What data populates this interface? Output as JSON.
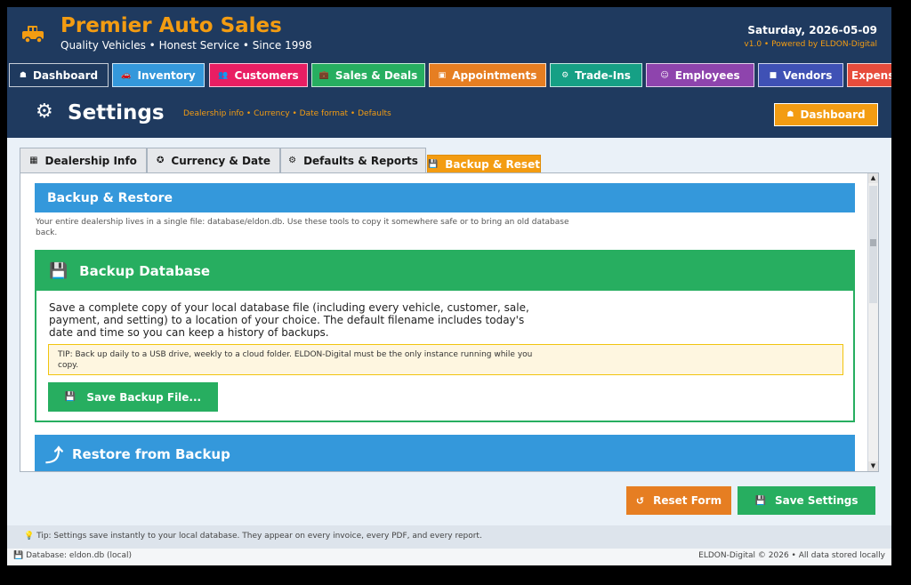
{
  "header": {
    "app_title": "Premier Auto Sales",
    "tagline": "Quality Vehicles  •  Honest Service  •  Since 1998",
    "date": "Saturday, 2026-05-09",
    "version": "v1.0  •  Powered by ELDON-Digital",
    "logo_icon": "car-icon"
  },
  "nav": {
    "items": [
      {
        "label": "Dashboard",
        "icon": "home-icon",
        "glyph": "☗",
        "color": "#1f3a5f"
      },
      {
        "label": "Inventory",
        "icon": "car-icon",
        "glyph": "🚗",
        "color": "#3498db"
      },
      {
        "label": "Customers",
        "icon": "people-icon",
        "glyph": "👥",
        "color": "#e91e63"
      },
      {
        "label": "Sales & Deals",
        "icon": "briefcase-icon",
        "glyph": "💼",
        "color": "#27ae60"
      },
      {
        "label": "Appointments",
        "icon": "calendar-icon",
        "glyph": "▣",
        "color": "#e67e22"
      },
      {
        "label": "Trade-Ins",
        "icon": "exchange-icon",
        "glyph": "⚙",
        "color": "#16a085"
      },
      {
        "label": "Employees",
        "icon": "team-icon",
        "glyph": "☺",
        "color": "#8e44ad"
      },
      {
        "label": "Vendors",
        "icon": "box-icon",
        "glyph": "■",
        "color": "#3f51b5"
      },
      {
        "label": "Expens",
        "icon": "",
        "glyph": "",
        "color": "#e74c3c"
      }
    ]
  },
  "page": {
    "title": "Settings",
    "icon": "gear-icon",
    "subtitle": "Dealership info • Currency • Date format • Defaults",
    "dashboard_button": "Dashboard"
  },
  "tabs": [
    {
      "label": "Dealership Info",
      "icon": "building-icon",
      "glyph": "▦"
    },
    {
      "label": "Currency & Date",
      "icon": "globe-icon",
      "glyph": "✪"
    },
    {
      "label": "Defaults & Reports",
      "icon": "gear-icon",
      "glyph": "⚙"
    },
    {
      "label": "Backup & Reset",
      "icon": "floppy-icon",
      "glyph": "💾",
      "active": true
    }
  ],
  "backup": {
    "section_title": "Backup & Restore",
    "intro": "Your entire dealership lives in a single file: database/eldon.db. Use these tools to copy it somewhere safe or to bring an old database back.",
    "card_title": "Backup Database",
    "card_desc": "Save a complete copy of your local database file (including every vehicle, customer, sale, payment, and setting) to a location of your choice. The default filename includes today's date and time so you can keep a history of backups.",
    "tip": "TIP: Back up daily to a USB drive, weekly to a cloud folder. ELDON-Digital must be the only instance running while you copy.",
    "save_button": "Save Backup File...",
    "restore_title": "Restore from Backup"
  },
  "actions": {
    "reset": "Reset Form",
    "save": "Save Settings",
    "reset_color": "#e67e22",
    "save_color": "#27ae60"
  },
  "footer": {
    "tip": "Tip: Settings save instantly to your local database. They appear on every invoice, every PDF, and every report.",
    "db": "Database: eldon.db (local)",
    "copyright": "ELDON-Digital © 2026  •  All data stored locally"
  }
}
